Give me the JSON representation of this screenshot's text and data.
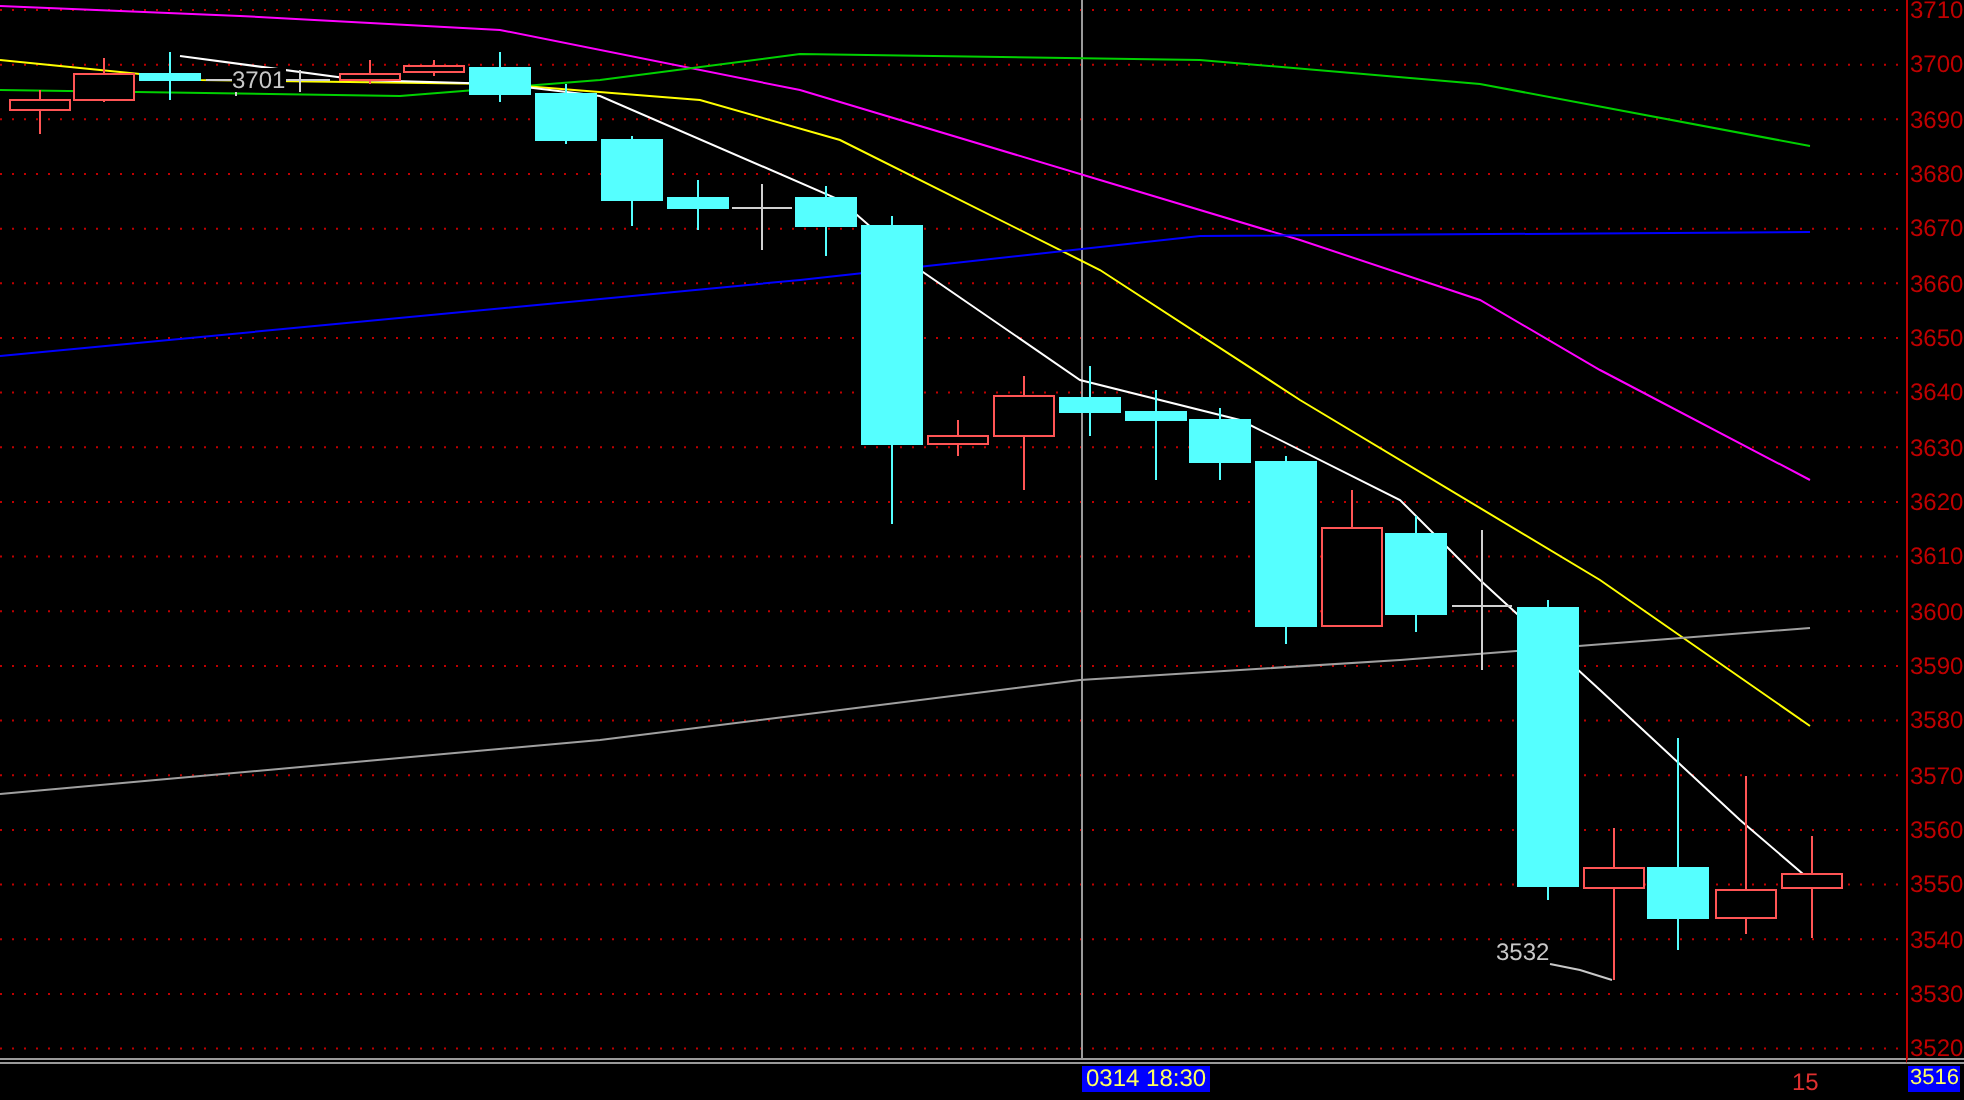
{
  "price_axis": {
    "labels": [
      "3710",
      "3700",
      "3690",
      "3680",
      "3670",
      "3660",
      "3650",
      "3640",
      "3630",
      "3620",
      "3610",
      "3600",
      "3590",
      "3580",
      "3570",
      "3560",
      "3550",
      "3540",
      "3530",
      "3520"
    ]
  },
  "chart_annotations": [
    {
      "kind": "high",
      "text": "3701"
    },
    {
      "kind": "low",
      "text": "3532"
    }
  ],
  "crosshair": {
    "time": "0314 18:30",
    "price": "3516"
  },
  "bottom_count": "15"
}
